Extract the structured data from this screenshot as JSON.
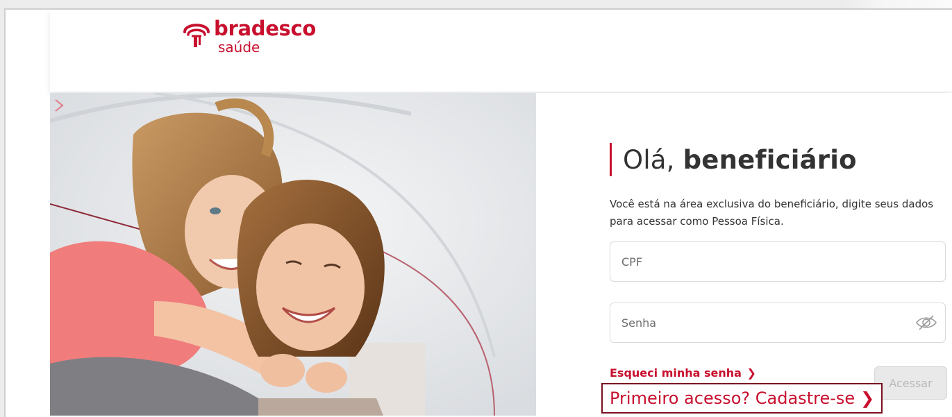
{
  "brand": {
    "name": "bradesco",
    "sub": "saúde",
    "color": "#c8102e"
  },
  "login": {
    "greeting_prefix": "Olá, ",
    "greeting_bold": "beneficiário",
    "description": "Você está na área exclusiva do beneficiário, digite seus dados para acessar como Pessoa Física.",
    "cpf_placeholder": "CPF",
    "cpf_value": "",
    "password_placeholder": "Senha",
    "password_value": "",
    "forgot_label": "Esqueci minha senha",
    "forgot_icon": "chevron-right-icon",
    "enter_label": "Acessar",
    "first_access_label": "Primeiro acesso? Cadastre-se",
    "first_access_icon": "chevron-right-icon",
    "show_password_icon": "eye-slash-icon"
  },
  "colors": {
    "accent": "#c8102e",
    "disabled_button_bg": "#e9e9e9",
    "disabled_button_text": "#b9b9b9"
  }
}
